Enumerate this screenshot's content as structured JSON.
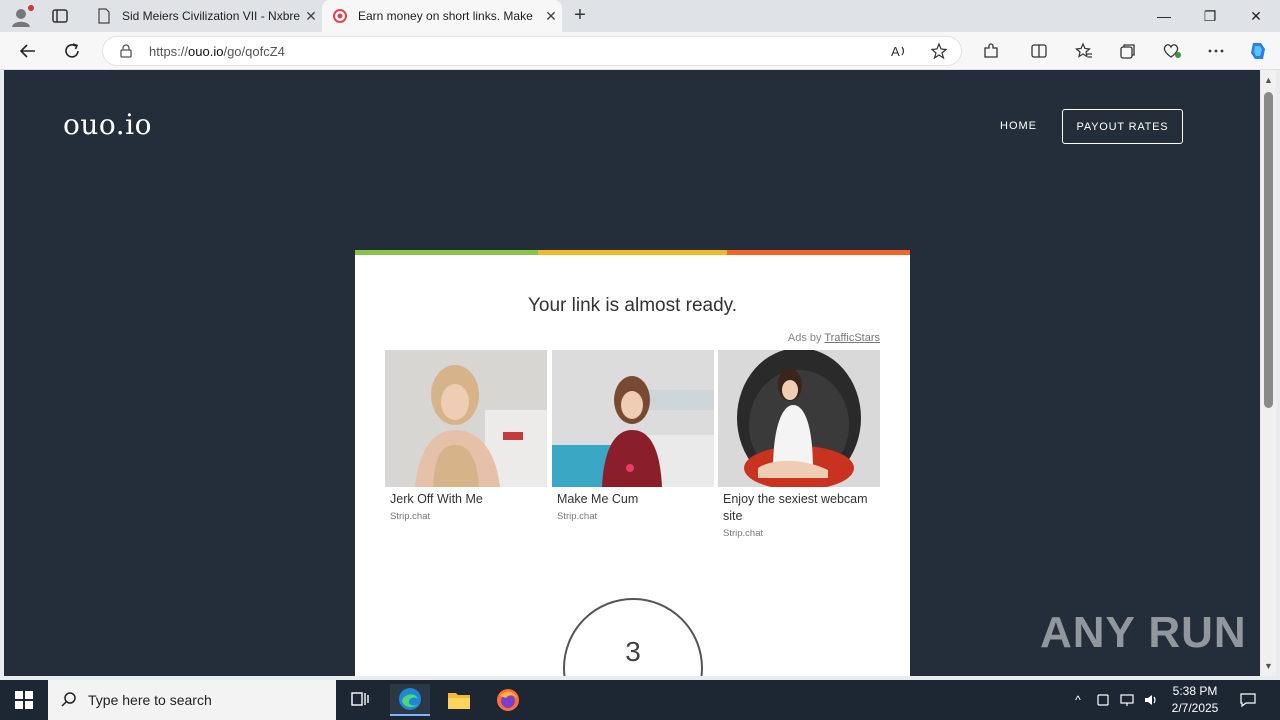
{
  "browser": {
    "tabs": [
      {
        "title": "Sid Meiers Civilization VII - Nxbre",
        "active": false
      },
      {
        "title": "Earn money on short links. Make",
        "active": true
      }
    ],
    "url_prefix": "https://",
    "url_host": "ouo.io",
    "url_path": "/go/qofcZ4"
  },
  "site": {
    "logo": "ouo.io",
    "nav": {
      "home": "HOME",
      "payout": "PAYOUT RATES"
    }
  },
  "card": {
    "heading": "Your link is almost ready.",
    "ads_by_prefix": "Ads by",
    "ads_by_link": "TrafficStars",
    "ads": [
      {
        "caption": "Jerk Off With Me",
        "source": "Strip.chat"
      },
      {
        "caption": "Make Me Cum",
        "source": "Strip.chat"
      },
      {
        "caption": "Enjoy the sexiest webcam site",
        "source": "Strip.chat"
      }
    ],
    "countdown": "3",
    "stripe_colors": [
      "#8bc34a",
      "#f0b92c",
      "#f26522"
    ]
  },
  "watermark": "ANY RUN",
  "taskbar": {
    "search_placeholder": "Type here to search",
    "time": "5:38 PM",
    "date": "2/7/2025"
  }
}
